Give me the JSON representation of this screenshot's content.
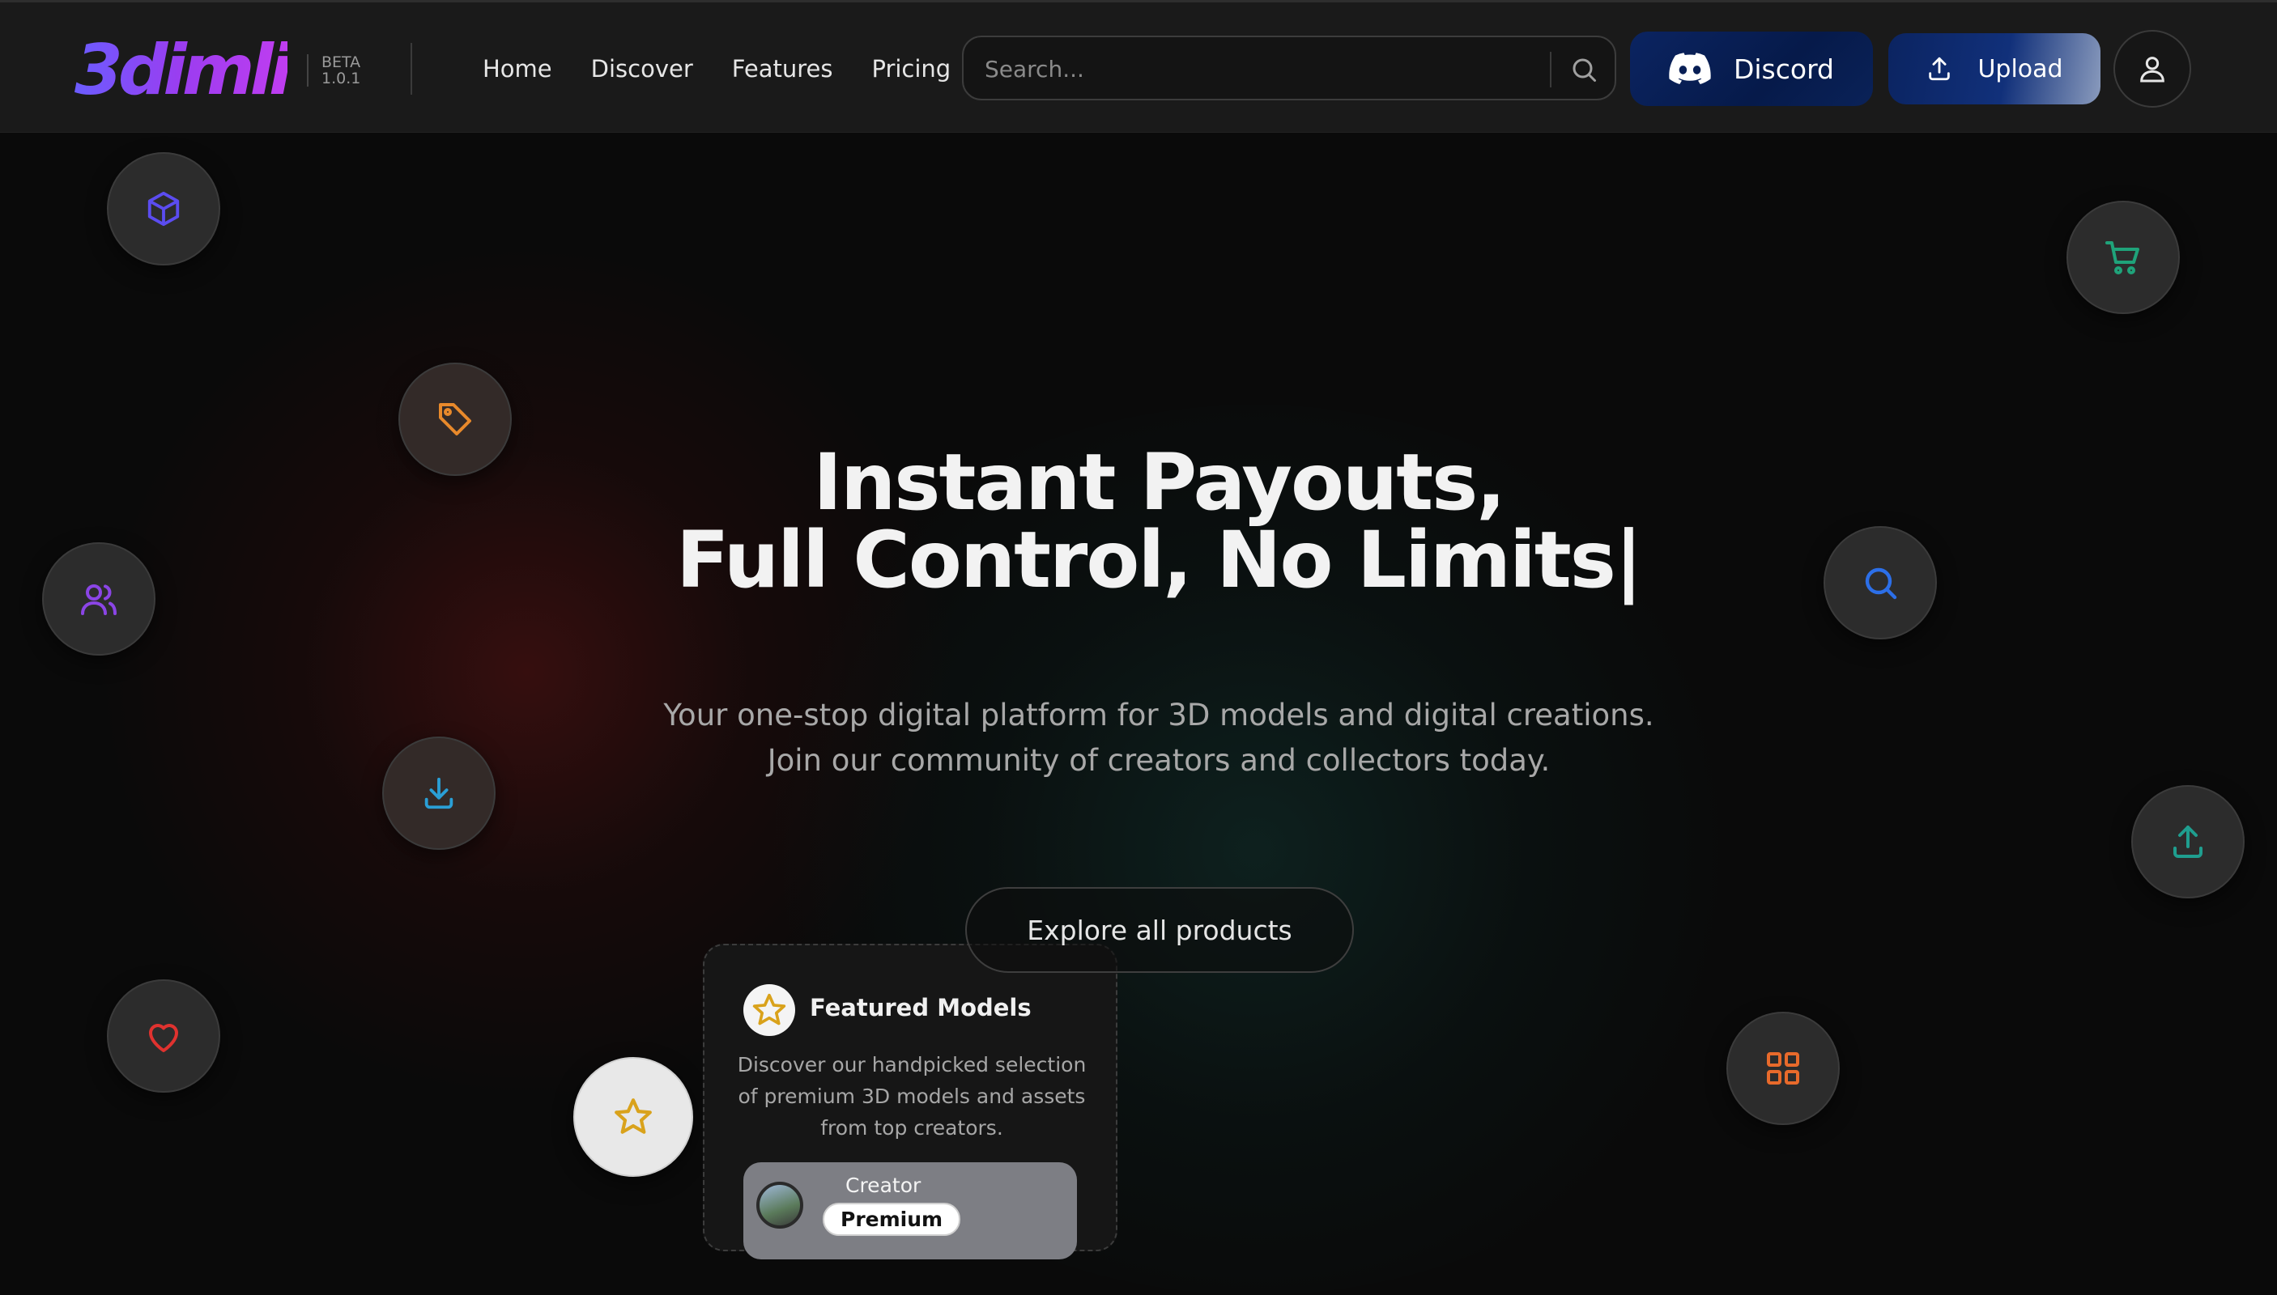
{
  "brand": {
    "logo_text": "3dimli",
    "beta_label": "BETA",
    "version": "1.0.1"
  },
  "nav": {
    "links": [
      "Home",
      "Discover",
      "Features",
      "Pricing"
    ]
  },
  "search": {
    "placeholder": "Search..."
  },
  "actions": {
    "discord_label": "Discord",
    "upload_label": "Upload"
  },
  "hero": {
    "title_line1": "Instant Payouts,",
    "title_line2": "Full Control, No Limits|",
    "subtitle_line1": "Your one-stop digital platform for 3D models and digital creations.",
    "subtitle_line2": "Join our community of creators and collectors today.",
    "cta_label": "Explore all products"
  },
  "featured_card": {
    "title": "Featured Models",
    "description": "Discover our handpicked selection of premium 3D models and assets from top creators.",
    "creator_label": "Creator",
    "badge": "Premium"
  },
  "icons": {
    "cube": "cube-icon",
    "tag": "tag-icon",
    "users": "users-icon",
    "download": "download-icon",
    "heart": "heart-icon",
    "star": "star-icon",
    "cart": "cart-icon",
    "search": "search-icon",
    "upload": "upload-icon",
    "grid": "grid-icon",
    "user": "user-icon",
    "discord": "discord-icon"
  },
  "colors": {
    "brand_gradient_start": "#6b5cff",
    "brand_gradient_end": "#c03df0",
    "cube": "#5b4cf0",
    "tag": "#e8892b",
    "users": "#8b45e6",
    "download": "#2a9fd6",
    "heart": "#e0322f",
    "star": "#d9a21b",
    "cart": "#1fa37a",
    "search": "#2c6fe8",
    "upload": "#1f9e8f",
    "grid": "#e86a2b"
  }
}
